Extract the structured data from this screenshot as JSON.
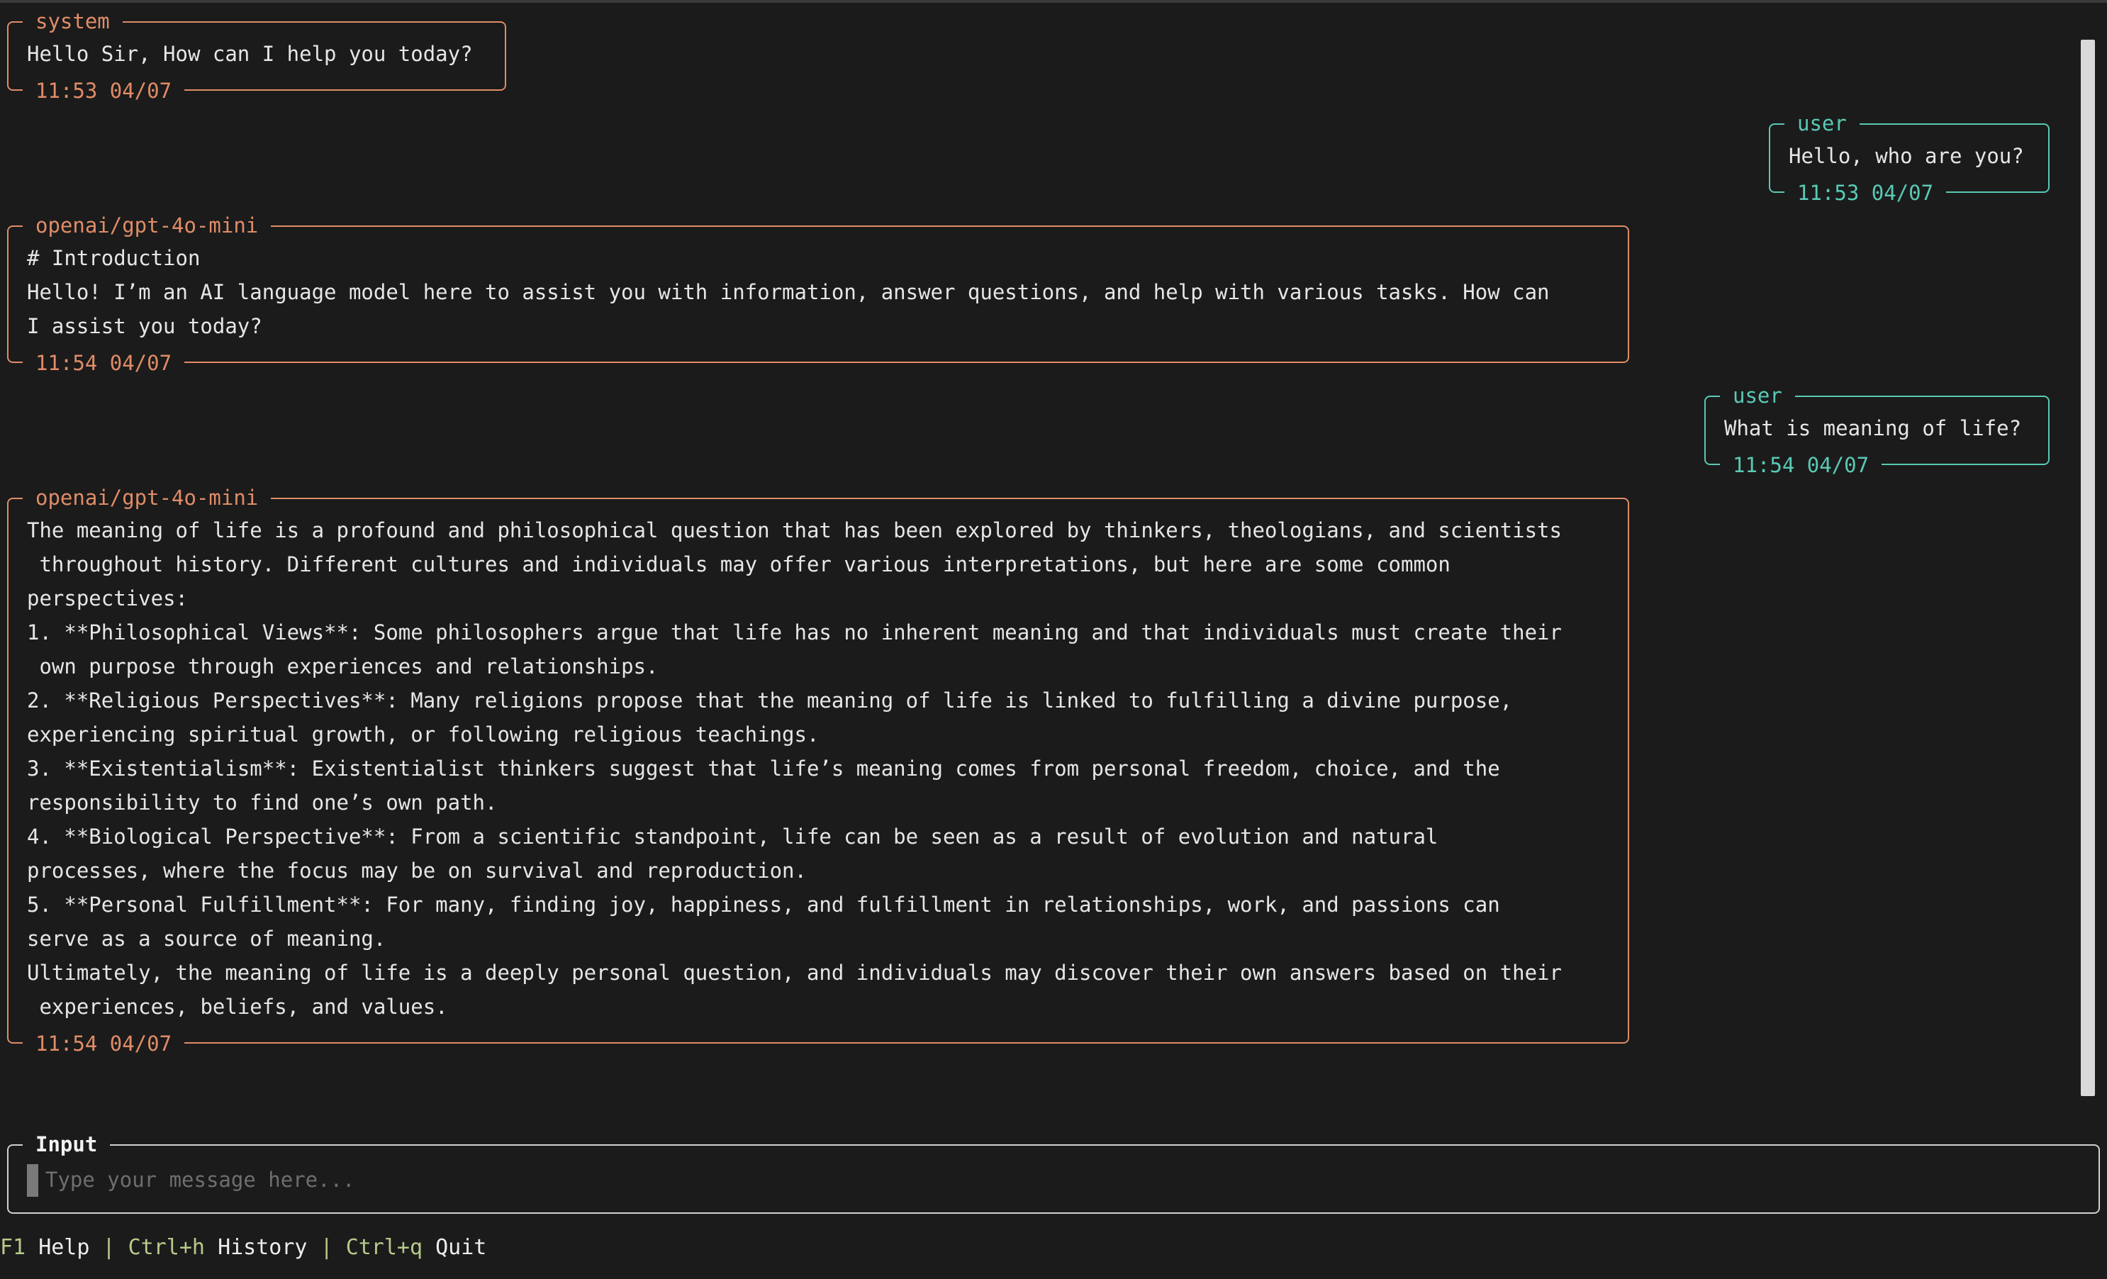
{
  "messages": [
    {
      "role": "system",
      "text": "Hello Sir, How can I help you today?",
      "time": "11:53 04/07"
    },
    {
      "role": "user",
      "text": "Hello, who are you?",
      "time": "11:53 04/07"
    },
    {
      "role": "openai/gpt-4o-mini",
      "text": "# Introduction\nHello! I’m an AI language model here to assist you with information, answer questions, and help with various tasks. How can\nI assist you today?",
      "time": "11:54 04/07"
    },
    {
      "role": "user",
      "text": "What is meaning of life?",
      "time": "11:54 04/07"
    },
    {
      "role": "openai/gpt-4o-mini",
      "text": "The meaning of life is a profound and philosophical question that has been explored by thinkers, theologians, and scientists\n throughout history. Different cultures and individuals may offer various interpretations, but here are some common\nperspectives:\n1. **Philosophical Views**: Some philosophers argue that life has no inherent meaning and that individuals must create their\n own purpose through experiences and relationships.\n2. **Religious Perspectives**: Many religions propose that the meaning of life is linked to fulfilling a divine purpose,\nexperiencing spiritual growth, or following religious teachings.\n3. **Existentialism**: Existentialist thinkers suggest that life’s meaning comes from personal freedom, choice, and the\nresponsibility to find one’s own path.\n4. **Biological Perspective**: From a scientific standpoint, life can be seen as a result of evolution and natural\nprocesses, where the focus may be on survival and reproduction.\n5. **Personal Fulfillment**: For many, finding joy, happiness, and fulfillment in relationships, work, and passions can\nserve as a source of meaning.\nUltimately, the meaning of life is a deeply personal question, and individuals may discover their own answers based on their\n experiences, beliefs, and values.",
      "time": "11:54 04/07"
    }
  ],
  "input": {
    "title": "Input",
    "placeholder": "Type your message here...",
    "value": ""
  },
  "footer": {
    "help_key": "F1",
    "help_label": "Help",
    "separator": "|",
    "history_key": "Ctrl+h",
    "history_label": "History",
    "quit_key": "Ctrl+q",
    "quit_label": "Quit"
  },
  "colors": {
    "background": "#1b1b1b",
    "assistant_border": "#e08c67",
    "user_border": "#5ac9b5",
    "footer_key": "#b7c98a"
  }
}
